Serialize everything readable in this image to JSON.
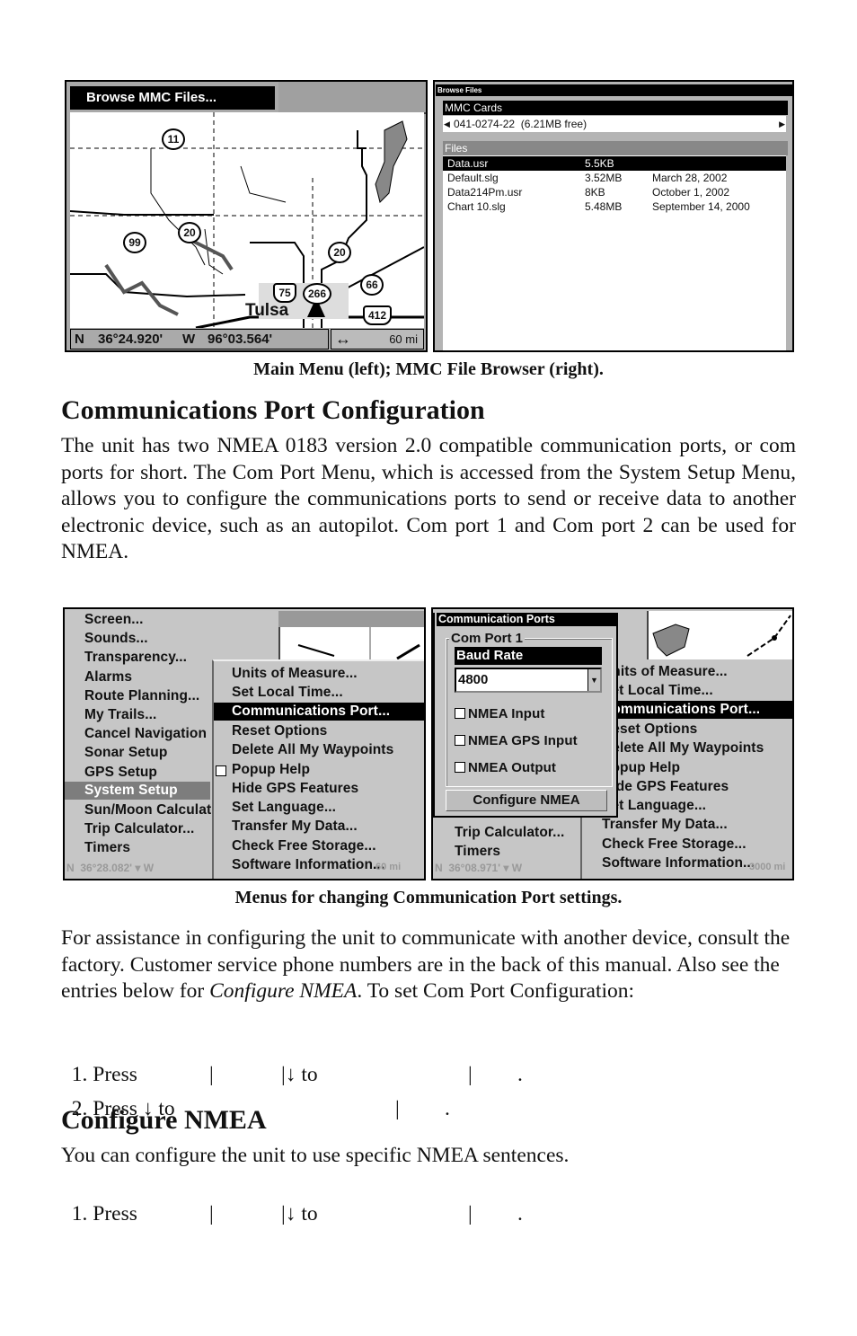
{
  "figure1": {
    "main_menu": {
      "menu_item": "Browse MMC Files...",
      "map_labels": [
        "11",
        "20",
        "99",
        "20",
        "75",
        "266",
        "66",
        "412"
      ],
      "city": "Tulsa",
      "lat_prefix": "N",
      "lat": "36°24.920'",
      "lon_prefix": "W",
      "lon": "96°03.564'",
      "zoom_icon": "left-right-arrow-icon",
      "scale": "60 mi"
    },
    "browser": {
      "title": "Browse Files",
      "cards_label": "MMC Cards",
      "card_value": "041-0274-22  (6.21MB free)",
      "files_label": "Files",
      "files": [
        {
          "name": "Data.usr",
          "size": "5.5KB",
          "date": ""
        },
        {
          "name": "Default.slg",
          "size": "3.52MB",
          "date": "March 28, 2002"
        },
        {
          "name": "Data214Pm.usr",
          "size": "8KB",
          "date": "October 1, 2002"
        },
        {
          "name": "Chart 10.slg",
          "size": "5.48MB",
          "date": "September 14, 2000"
        }
      ]
    },
    "caption": "Main Menu (left); MMC File Browser (right)."
  },
  "section1": {
    "heading": "Communications Port Configuration",
    "paragraph": "The unit has two NMEA 0183 version 2.0 compatible communication ports, or com ports for short. The Com Port Menu, which is accessed from the System Setup Menu, allows you to configure the communications ports to send or receive data to another electronic device, such as an autopilot. Com port 1 and Com port 2 can be used for NMEA."
  },
  "figure2": {
    "main_menu": [
      "Screen...",
      "Sounds...",
      "Transparency...",
      "Alarms",
      "Route Planning...",
      "My Trails...",
      "Cancel Navigation",
      "Sonar Setup",
      "GPS Setup",
      "System Setup",
      "Sun/Moon Calculat",
      "Trip Calculator...",
      "Timers"
    ],
    "main_menu_selected": "System Setup",
    "submenu": [
      "Units of Measure...",
      "Set Local Time...",
      "Communications Port...",
      "Reset Options",
      "Delete All My Waypoints",
      "Popup Help",
      "Hide GPS Features",
      "Set Language...",
      "Transfer My Data...",
      "Check Free Storage...",
      "Software Information..."
    ],
    "submenu_selected": "Communications Port...",
    "status_left": "N  36°28.082' ▾ W",
    "status_right": "60 mi",
    "dialog": {
      "title": "Communication Ports",
      "group": "Com Port 1",
      "baud_label": "Baud Rate",
      "baud_value": "4800",
      "checkboxes": [
        {
          "label": "NMEA Input",
          "checked": false
        },
        {
          "label": "NMEA GPS Input",
          "checked": false
        },
        {
          "label": "NMEA Output",
          "checked": false
        }
      ],
      "button": "Configure NMEA"
    },
    "right_bg_menu": [
      "Trip Calculator...",
      "Timers"
    ],
    "right_status_left": "N  36°08.971' ▾ W",
    "right_status_right": "3000 mi",
    "caption": "Menus for changing Communication Port settings."
  },
  "section1b": {
    "para_a": "For assistance in configuring the unit to communicate with another device, consult the factory. Customer service phone numbers are in the back of this manual. Also see the entries below for ",
    "para_em": "Configure NMEA",
    "para_b": ". To set Com Port Configuration:",
    "step1": [
      "1. Press",
      "|",
      "|↓ to",
      "|",
      "."
    ],
    "step2": [
      "2. Press ↓ to",
      "|",
      "."
    ]
  },
  "section2": {
    "heading": "Configure NMEA",
    "paragraph": "You can configure the unit to use specific NMEA sentences.",
    "step1": [
      "1. Press",
      "|",
      "|↓ to",
      "|",
      "."
    ]
  }
}
